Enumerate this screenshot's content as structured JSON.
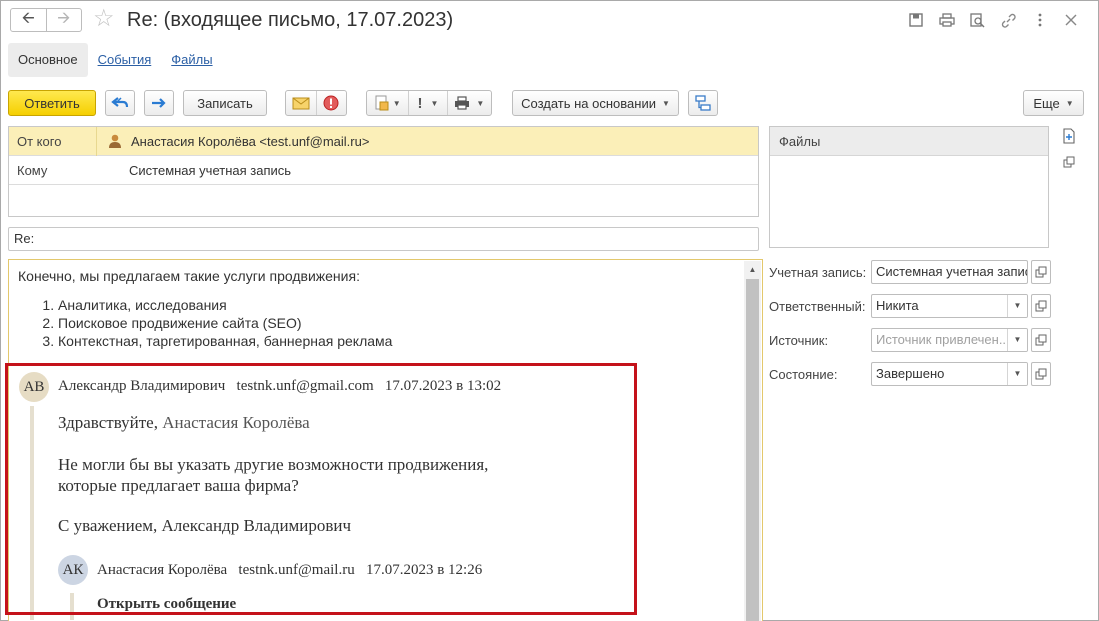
{
  "window": {
    "title": "Re: (входящее письмо, 17.07.2023)",
    "back_icon": "arrow-left-icon",
    "forward_icon": "arrow-right-icon",
    "favorite_icon": "star-icon",
    "toolbar_icons": [
      "save-icon",
      "print-icon",
      "preview-icon",
      "link-icon",
      "more-vertical-icon",
      "close-icon"
    ]
  },
  "tabs": [
    {
      "label": "Основное",
      "active": true
    },
    {
      "label": "События",
      "active": false
    },
    {
      "label": "Файлы",
      "active": false
    }
  ],
  "toolbar": {
    "reply_label": "Ответить",
    "save_label": "Записать",
    "create_based_label": "Создать на основании",
    "more_label": "Еще",
    "accent": "#f5cf00"
  },
  "header": {
    "from_label": "От кого",
    "from_value": "Анастасия Королёва <test.unf@mail.ru>",
    "to_label": "Кому",
    "to_value": "Системная учетная запись",
    "subject_value": "Re:"
  },
  "message": {
    "intro": "Конечно, мы предлагаем такие услуги продвижения:",
    "list": [
      "Аналитика, исследования",
      "Поисковое продвижение сайта (SEO)",
      "Контекстная, таргетированная, баннерная реклама"
    ],
    "quote1": {
      "initials": "АВ",
      "sender": "Александр Владимирович",
      "email": "testnk.unf@gmail.com",
      "date": "17.07.2023 в 13:02",
      "greeting": "Здравствуйте,",
      "greeting_name": "Анастасия Королёва",
      "line1": "Не могли бы вы указать другие возможности продвижения,",
      "line2": "которые предлагает ваша фирма?",
      "signature": "С уважением, Александр Владимирович"
    },
    "quote2": {
      "initials": "АК",
      "sender": "Анастасия Королёва",
      "email": "testnk.unf@mail.ru",
      "date": "17.07.2023 в 12:26",
      "open_label": "Открыть сообщение"
    }
  },
  "files_panel": {
    "title": "Файлы"
  },
  "fields": {
    "account_label": "Учетная запись:",
    "account_value": "Системная учетная запис",
    "responsible_label": "Ответственный:",
    "responsible_value": "Никита",
    "source_label": "Источник:",
    "source_placeholder": "Источник привлечен...",
    "state_label": "Состояние:",
    "state_value": "Завершено"
  }
}
